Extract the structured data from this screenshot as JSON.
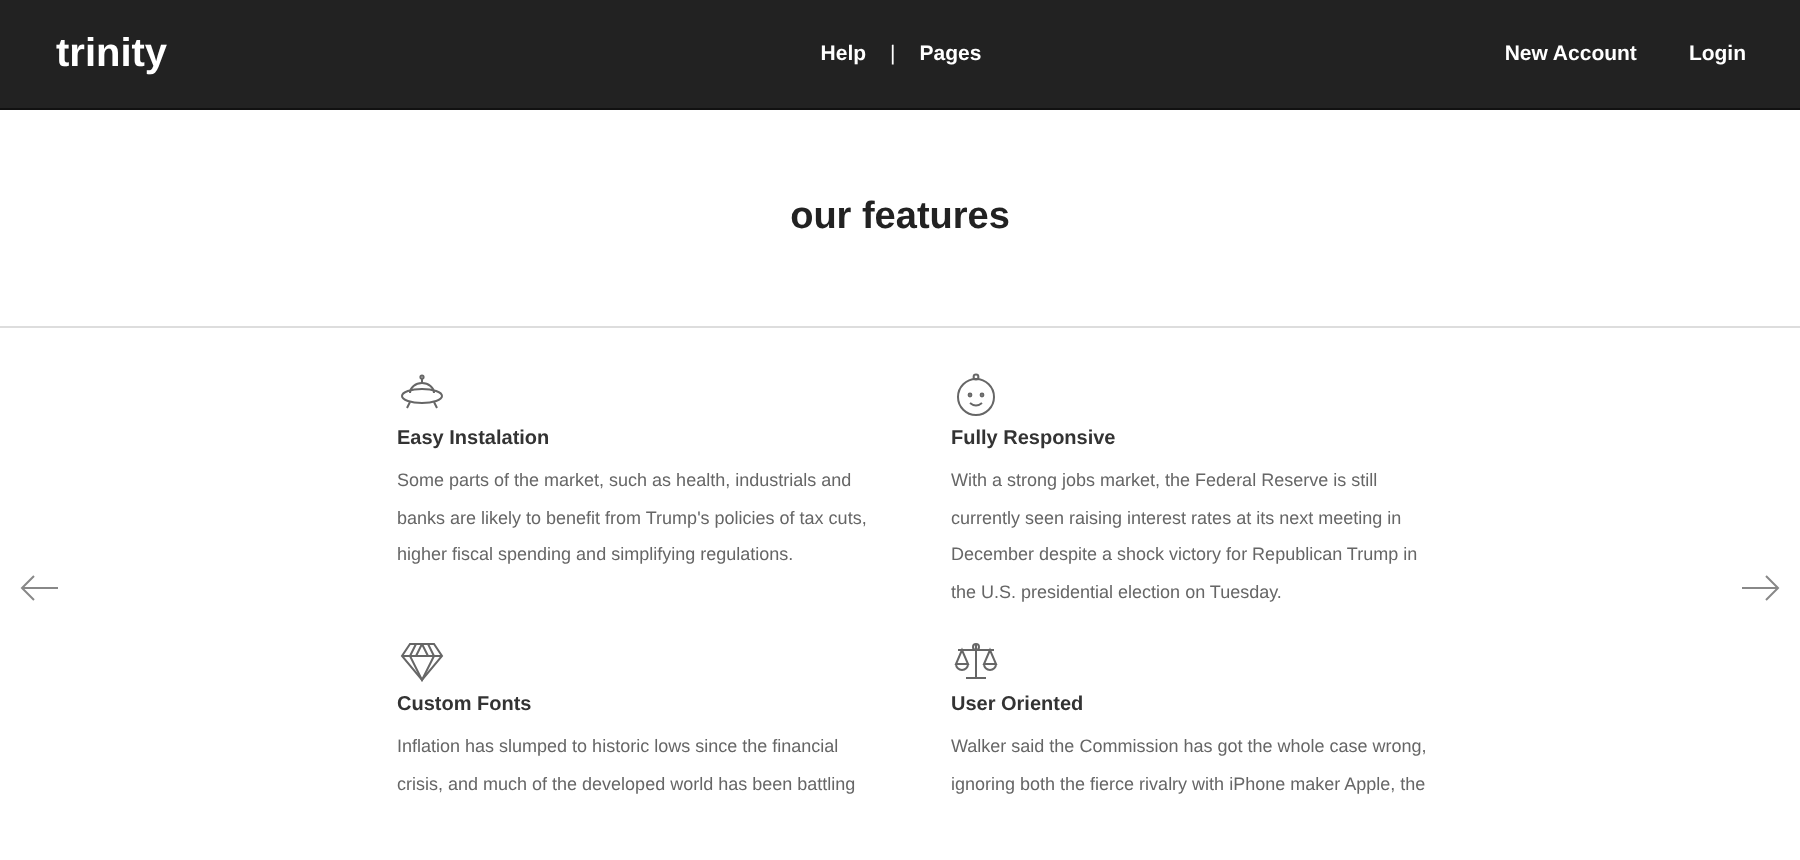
{
  "header": {
    "logo": "trinity",
    "nav": [
      "Help",
      "|",
      "Pages"
    ],
    "account": [
      "New Account",
      "Login"
    ]
  },
  "section": {
    "title": "our features"
  },
  "features": [
    {
      "title": "Easy Instalation",
      "text": "Some parts of the market, such as health, industrials and banks are likely to benefit from Trump's policies of tax cuts, higher fiscal spending and simplifying regulations."
    },
    {
      "title": "Fully Responsive",
      "text": "With a strong jobs market, the Federal Reserve is still currently seen raising interest rates at its next meeting in December despite a shock victory for Republican Trump in the U.S. presidential election on Tuesday."
    },
    {
      "title": "Custom Fonts",
      "text": "Inflation has slumped to historic lows since the financial crisis, and much of the developed world has been battling"
    },
    {
      "title": "User Oriented",
      "text": "Walker said the Commission has got the whole case wrong, ignoring both the fierce rivalry with iPhone maker Apple, the"
    }
  ]
}
